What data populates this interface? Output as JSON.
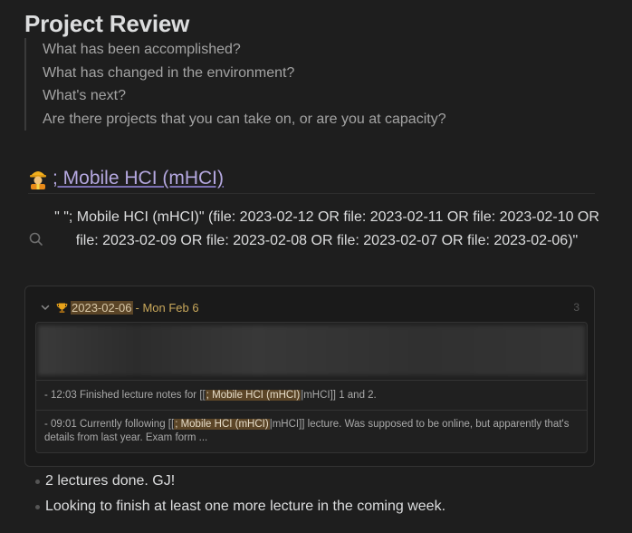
{
  "heading": "Project Review",
  "review_questions": [
    "What has been accomplished?",
    "What has changed in the environment?",
    "What's next?",
    "Are there projects that you can take on, or are you at capacity?"
  ],
  "section": {
    "link_text": "; Mobile HCI (mHCI)",
    "icon": "construction-worker-icon"
  },
  "query": {
    "text": "\" \"; Mobile HCI (mHCI)\" (file: 2023-02-12 OR file: 2023-02-11 OR file: 2023-02-10 OR file: 2023-02-09 OR file: 2023-02-08 OR file: 2023-02-07 OR file: 2023-02-06)\""
  },
  "result": {
    "date": "2023-02-06",
    "day_label": " - Mon Feb 6",
    "count": "3",
    "entries": [
      {
        "prefix": "- 12:03 Finished lecture notes for [[",
        "highlight": "; Mobile HCI (mHCI)",
        "suffix": "|mHCI]] 1 and 2."
      },
      {
        "prefix": "- 09:01 Currently following [[",
        "highlight": "; Mobile HCI (mHCI)",
        "suffix": "|mHCI]] lecture. Was supposed to be online, but apparently that's details from last year. Exam form ..."
      }
    ]
  },
  "notes": [
    "2 lectures done. GJ!",
    "Looking to finish at least one more lecture in the coming week."
  ],
  "colors": {
    "background": "#1e1e1e",
    "link": "#b5a8e0",
    "highlight": "#5b4527",
    "date_accent": "#c9a85b"
  }
}
